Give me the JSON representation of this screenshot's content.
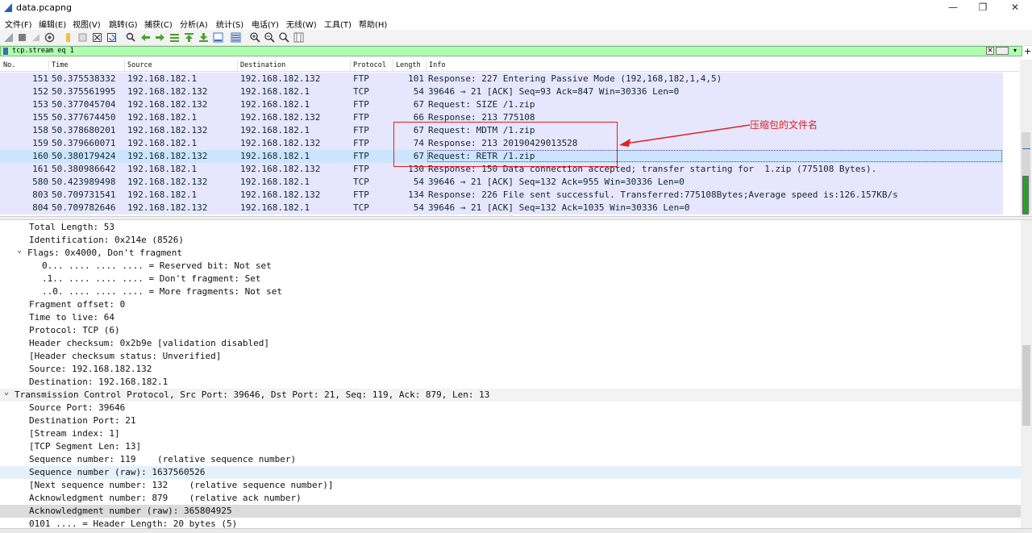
{
  "window": {
    "title": "data.pcapng",
    "minimize": "—",
    "restore": "❐",
    "close": "✕"
  },
  "menu": [
    "文件(F)",
    "编辑(E)",
    "视图(V)",
    "跳转(G)",
    "捕获(C)",
    "分析(A)",
    "统计(S)",
    "电话(Y)",
    "无线(W)",
    "工具(T)",
    "帮助(H)"
  ],
  "filter": {
    "value": "tcp.stream eq 1",
    "clear": "✕",
    "dropdown": "▾",
    "add": "+"
  },
  "columns": [
    "No.",
    "Time",
    "Source",
    "Destination",
    "Protocol",
    "Length",
    "Info"
  ],
  "packets": [
    {
      "no": "151",
      "time": "50.375538332",
      "src": "192.168.182.1",
      "dst": "192.168.182.132",
      "proto": "FTP",
      "len": "101",
      "info": "Response: 227 Entering Passive Mode (192,168,182,1,4,5)"
    },
    {
      "no": "152",
      "time": "50.375561995",
      "src": "192.168.182.132",
      "dst": "192.168.182.1",
      "proto": "TCP",
      "len": "54",
      "info": "39646 → 21 [ACK] Seq=93 Ack=847 Win=30336 Len=0"
    },
    {
      "no": "153",
      "time": "50.377045704",
      "src": "192.168.182.132",
      "dst": "192.168.182.1",
      "proto": "FTP",
      "len": "67",
      "info": "Request: SIZE /1.zip"
    },
    {
      "no": "155",
      "time": "50.377674450",
      "src": "192.168.182.1",
      "dst": "192.168.182.132",
      "proto": "FTP",
      "len": "66",
      "info": "Response: 213 775108"
    },
    {
      "no": "158",
      "time": "50.378680201",
      "src": "192.168.182.132",
      "dst": "192.168.182.1",
      "proto": "FTP",
      "len": "67",
      "info": "Request: MDTM /1.zip"
    },
    {
      "no": "159",
      "time": "50.379660071",
      "src": "192.168.182.1",
      "dst": "192.168.182.132",
      "proto": "FTP",
      "len": "74",
      "info": "Response: 213 20190429013528"
    },
    {
      "no": "160",
      "time": "50.380179424",
      "src": "192.168.182.132",
      "dst": "192.168.182.1",
      "proto": "FTP",
      "len": "67",
      "info": "Request: RETR /1.zip"
    },
    {
      "no": "161",
      "time": "50.380986642",
      "src": "192.168.182.1",
      "dst": "192.168.182.132",
      "proto": "FTP",
      "len": "130",
      "info": "Response: 150 Data connection accepted; transfer starting for  1.zip (775108 Bytes)."
    },
    {
      "no": "580",
      "time": "50.423989498",
      "src": "192.168.182.132",
      "dst": "192.168.182.1",
      "proto": "TCP",
      "len": "54",
      "info": "39646 → 21 [ACK] Seq=132 Ack=955 Win=30336 Len=0"
    },
    {
      "no": "803",
      "time": "50.709731541",
      "src": "192.168.182.1",
      "dst": "192.168.182.132",
      "proto": "FTP",
      "len": "134",
      "info": "Response: 226 File sent successful. Transferred:775108Bytes;Average speed is:126.157KB/s"
    },
    {
      "no": "804",
      "time": "50.709782646",
      "src": "192.168.182.132",
      "dst": "192.168.182.1",
      "proto": "TCP",
      "len": "54",
      "info": "39646 → 21 [ACK] Seq=132 Ack=1035 Win=30336 Len=0"
    }
  ],
  "selected_packet": "160",
  "annotation": {
    "text": "压缩包的文件名",
    "color": "#e02020"
  },
  "details": [
    {
      "indent": 2,
      "arrow": "",
      "text": "Total Length: 53"
    },
    {
      "indent": 2,
      "arrow": "",
      "text": "Identification: 0x214e (8526)"
    },
    {
      "indent": 1,
      "arrow": "v",
      "text": "Flags: 0x4000, Don't fragment"
    },
    {
      "indent": 3,
      "arrow": "",
      "text": "0... .... .... .... = Reserved bit: Not set"
    },
    {
      "indent": 3,
      "arrow": "",
      "text": ".1.. .... .... .... = Don't fragment: Set"
    },
    {
      "indent": 3,
      "arrow": "",
      "text": "..0. .... .... .... = More fragments: Not set"
    },
    {
      "indent": 2,
      "arrow": "",
      "text": "Fragment offset: 0"
    },
    {
      "indent": 2,
      "arrow": "",
      "text": "Time to live: 64"
    },
    {
      "indent": 2,
      "arrow": "",
      "text": "Protocol: TCP (6)"
    },
    {
      "indent": 2,
      "arrow": "",
      "text": "Header checksum: 0x2b9e [validation disabled]"
    },
    {
      "indent": 2,
      "arrow": "",
      "text": "[Header checksum status: Unverified]"
    },
    {
      "indent": 2,
      "arrow": "",
      "text": "Source: 192.168.182.132"
    },
    {
      "indent": 2,
      "arrow": "",
      "text": "Destination: 192.168.182.1"
    },
    {
      "indent": 0,
      "arrow": "v",
      "text": "Transmission Control Protocol, Src Port: 39646, Dst Port: 21, Seq: 119, Ack: 879, Len: 13",
      "hl": "hl3"
    },
    {
      "indent": 2,
      "arrow": "",
      "text": "Source Port: 39646"
    },
    {
      "indent": 2,
      "arrow": "",
      "text": "Destination Port: 21"
    },
    {
      "indent": 2,
      "arrow": "",
      "text": "[Stream index: 1]"
    },
    {
      "indent": 2,
      "arrow": "",
      "text": "[TCP Segment Len: 13]"
    },
    {
      "indent": 2,
      "arrow": "",
      "text": "Sequence number: 119    (relative sequence number)"
    },
    {
      "indent": 2,
      "arrow": "",
      "text": "Sequence number (raw): 1637560526",
      "hl": "hl1"
    },
    {
      "indent": 2,
      "arrow": "",
      "text": "[Next sequence number: 132    (relative sequence number)]"
    },
    {
      "indent": 2,
      "arrow": "",
      "text": "Acknowledgment number: 879    (relative ack number)"
    },
    {
      "indent": 2,
      "arrow": "",
      "text": "Acknowledgment number (raw): 365804925",
      "hl": "hl2"
    },
    {
      "indent": 2,
      "arrow": "",
      "text": "0101 .... = Header Length: 20 bytes (5)"
    }
  ]
}
